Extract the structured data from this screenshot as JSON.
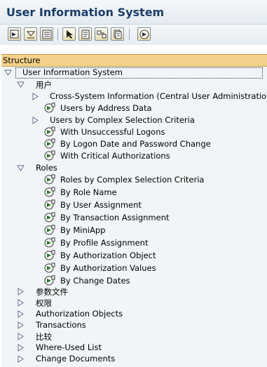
{
  "title": "User Information System",
  "toolbar": {
    "buttons": [
      "execute-icon",
      "expand-subtree-icon",
      "collapse-subtree-icon",
      "select-icon",
      "documentation-icon",
      "where-used-icon",
      "variants-icon",
      "timed-execute-icon"
    ]
  },
  "tree": {
    "header": "Structure",
    "root": "User Information System",
    "users_folder": "用户",
    "cross_system": "Cross-System Information (Central User Administration)",
    "users_by_address": "Users by Address Data",
    "users_complex": "Users by Complex Selection Criteria",
    "unsuccessful_logons": "With Unsuccessful Logons",
    "logon_date_pw": "By Logon Date and Password Change",
    "critical_auth": "With Critical Authorizations",
    "roles_folder": "Roles",
    "roles_items": [
      "Roles by Complex Selection Criteria",
      "By Role Name",
      "By User Assignment",
      "By Transaction Assignment",
      "By MiniApp",
      "By Profile Assignment",
      "By Authorization Object",
      "By Authorization Values",
      "By Change Dates"
    ],
    "bottom_folders": [
      "参数文件",
      "权限",
      "Authorization Objects",
      "Transactions",
      "比较",
      "Where-Used List",
      "Change Documents"
    ]
  },
  "colors": {
    "title": "#1a3e6c",
    "header_bg": "#f4d28b",
    "panel_bg": "#f1f5f8",
    "triangle": "#5d6a8a",
    "exec_icon": "#1f7a1f"
  }
}
